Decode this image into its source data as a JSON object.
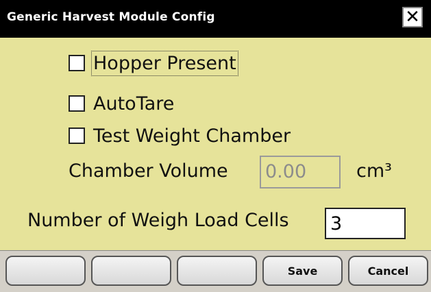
{
  "window": {
    "title": "Generic Harvest Module Config",
    "close_glyph": "✕"
  },
  "options": {
    "hopper_present": {
      "label": "Hopper Present",
      "checked": false
    },
    "auto_tare": {
      "label": "AutoTare",
      "checked": false
    },
    "test_weight_chamber": {
      "label": "Test Weight Chamber",
      "checked": false
    }
  },
  "chamber_volume": {
    "label": "Chamber Volume",
    "value": "0.00",
    "unit": "cm³",
    "enabled": false
  },
  "weigh_load_cells": {
    "label": "Number of Weigh Load Cells",
    "value": "3"
  },
  "softkeys": {
    "key1": "",
    "key2": "",
    "key3": "",
    "save": "Save",
    "cancel": "Cancel"
  }
}
